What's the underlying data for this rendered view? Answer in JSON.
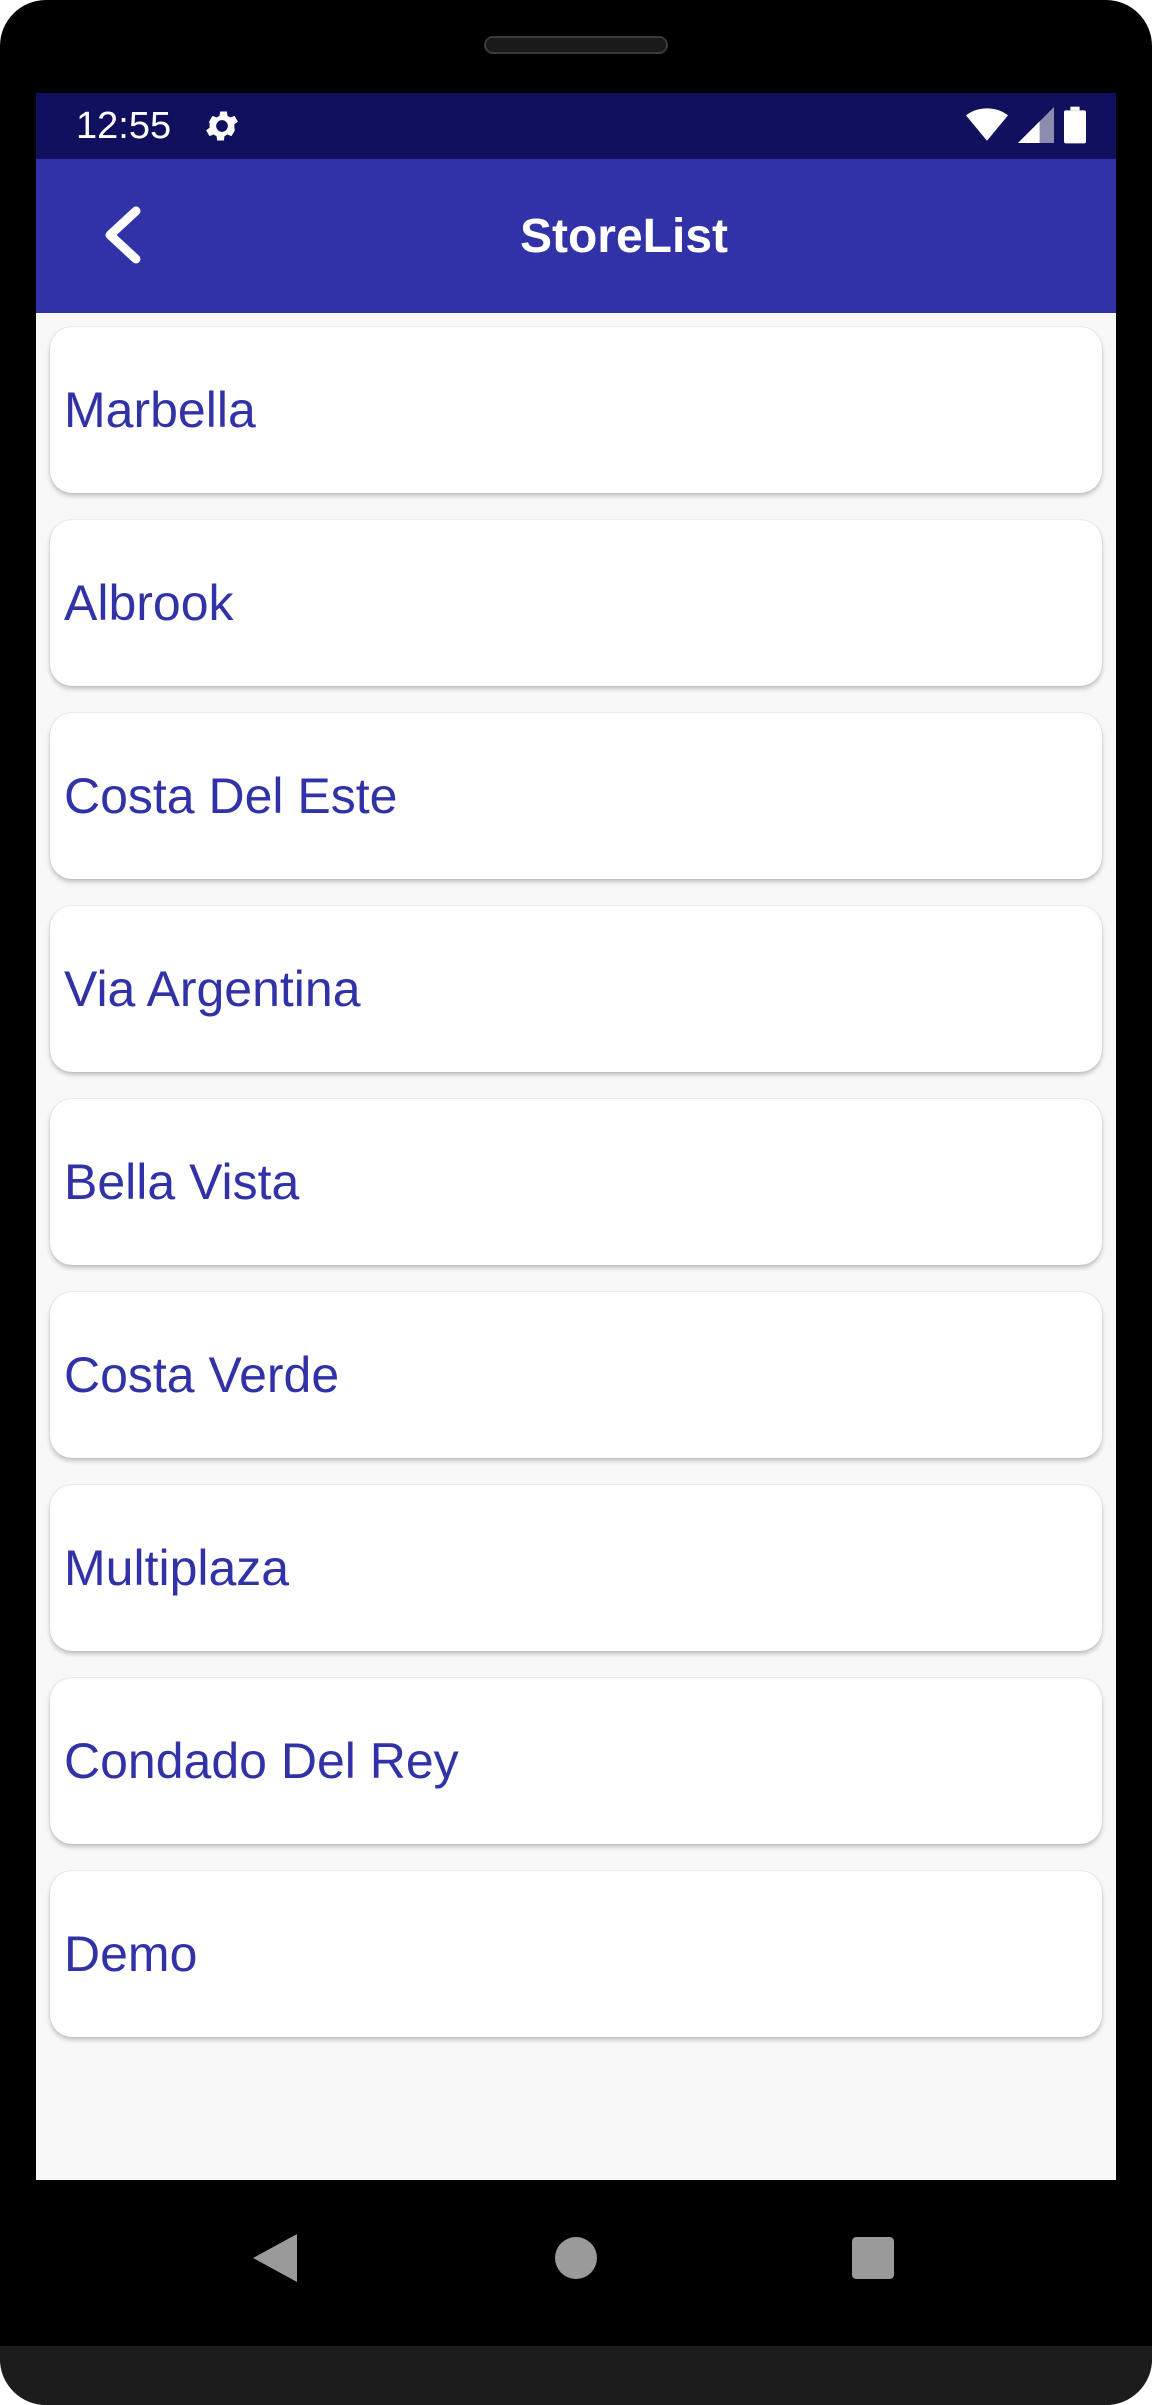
{
  "status_bar": {
    "time": "12:55",
    "icons": [
      "settings-gear-icon",
      "wifi-icon",
      "cell-signal-icon",
      "battery-icon"
    ]
  },
  "app_bar": {
    "title": "StoreList",
    "back_icon": "chevron-left-icon"
  },
  "stores": [
    {
      "name": "Marbella"
    },
    {
      "name": "Albrook"
    },
    {
      "name": "Costa Del Este"
    },
    {
      "name": "Via Argentina"
    },
    {
      "name": "Bella Vista"
    },
    {
      "name": "Costa Verde"
    },
    {
      "name": "Multiplaza"
    },
    {
      "name": "Condado Del Rey"
    },
    {
      "name": "Demo"
    }
  ],
  "nav_bar": {
    "icons": [
      "back-triangle-icon",
      "home-circle-icon",
      "recents-square-icon"
    ]
  },
  "colors": {
    "status_bar": "#10105e",
    "app_bar": "#3232a8",
    "store_text": "#3232a8",
    "list_background": "#f8f8f8"
  }
}
